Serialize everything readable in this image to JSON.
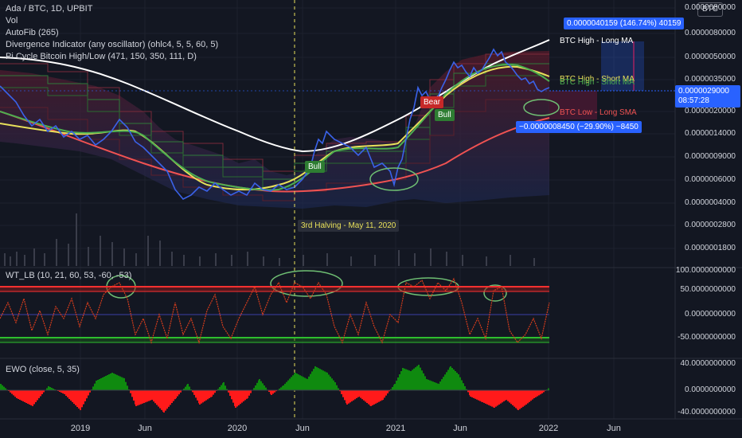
{
  "header": {
    "title": "Ada / BTC, 1D, UPBIT",
    "indicators": [
      "Vol",
      "AutoFib (265)",
      "Divergence Indicator (any oscillator) (ohlc4, 5, 5, 60, 5)",
      "Pi Cycle Bitcoin High/Low (471, 150, 350, 111, D)"
    ],
    "currency": "BTC"
  },
  "price_axis": {
    "ticks": [
      "0.0000080000",
      "0.0000050000",
      "0.0000035000",
      "0.0000020000",
      "0.0000014000",
      "0.0000009000",
      "0.0000006000",
      "0.0000004000",
      "0.0000002800",
      "0.0000001800"
    ],
    "last_price": "0.0000029000",
    "countdown": "08:57:28"
  },
  "oscillator": {
    "label": "WT_LB (10, 21, 60, 53, -60, -53)",
    "ticks": [
      "100.0000000000",
      "50.0000000000",
      "0.0000000000",
      "-50.0000000000"
    ]
  },
  "ewo": {
    "label": "EWO (close, 5, 35)",
    "ticks": [
      "40.0000000000",
      "0.0000000000",
      "-40.0000000000"
    ]
  },
  "time_axis": [
    "2019",
    "Jun",
    "2020",
    "Jun",
    "2021",
    "Jun",
    "2022",
    "Jun"
  ],
  "annotations": {
    "halving": "3rd Halving - May 11, 2020",
    "measure_up": "0.0000040159 (146.74%) 40159",
    "measure_down": "−0.0000008450 (−29.90%) −8450",
    "btc_high_long": "BTC High - Long MA",
    "btc_high_short": "BTC High - Short MA",
    "btc_low_long": "BTC Low - Long SMA",
    "bull1": "Bull",
    "bull2": "Bull",
    "bear": "Bear"
  },
  "colors": {
    "price": "#3a62e8",
    "white_ma": "#ffffff",
    "red_ma": "#f05252",
    "yellow_ma": "#e8e05a",
    "green_ma": "#4caf50",
    "accent_blue": "#2962ff",
    "ewo_up": "#0f8a0f",
    "ewo_down": "#ff1a1a"
  }
}
